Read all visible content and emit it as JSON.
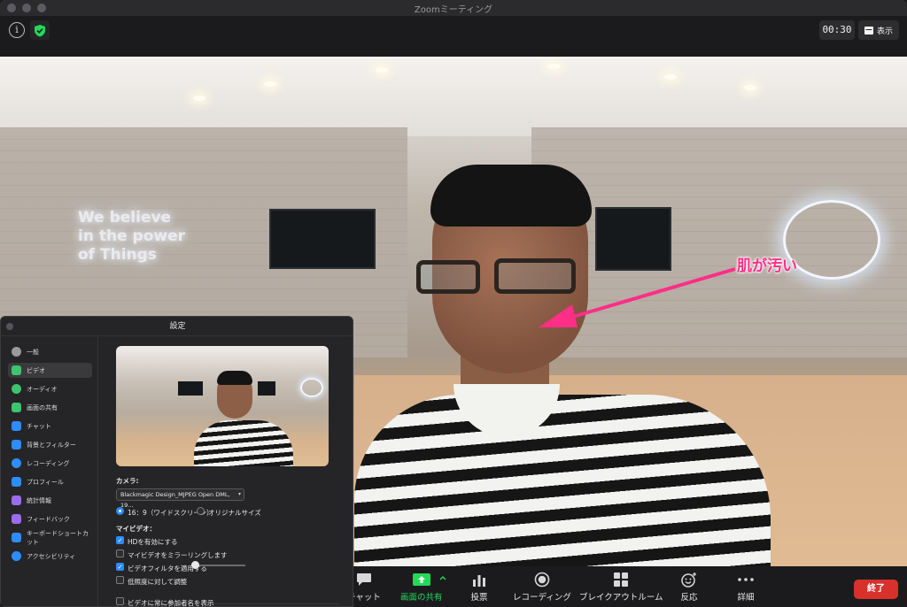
{
  "window": {
    "title": "Zoomミーティング"
  },
  "topbar": {
    "timer": "00:30",
    "view_label": "表示"
  },
  "annotation": {
    "text": "肌が汚い",
    "color": "#ff2e86"
  },
  "neon_sign": {
    "lines": [
      "We believe",
      "in the power",
      "of Things"
    ]
  },
  "toolbar": {
    "items": [
      {
        "label": "チャット",
        "icon": "chat-icon"
      },
      {
        "label": "画面の共有",
        "icon": "share-screen-icon"
      },
      {
        "label": "投票",
        "icon": "poll-icon"
      },
      {
        "label": "レコーディング",
        "icon": "record-icon"
      },
      {
        "label": "ブレイクアウトルーム",
        "icon": "breakout-icon"
      },
      {
        "label": "反応",
        "icon": "reaction-icon"
      },
      {
        "label": "詳細",
        "icon": "more-icon"
      }
    ],
    "end_label": "終了",
    "share_color": "#23d959",
    "end_color": "#d8312c"
  },
  "settings": {
    "title": "設定",
    "sidebar": [
      {
        "label": "一般",
        "color": "#9a9a9e"
      },
      {
        "label": "ビデオ",
        "color": "#3cc46e"
      },
      {
        "label": "オーディオ",
        "color": "#3cc46e"
      },
      {
        "label": "画面の共有",
        "color": "#3cc46e"
      },
      {
        "label": "チャット",
        "color": "#2d8cff"
      },
      {
        "label": "背景とフィルター",
        "color": "#2d8cff"
      },
      {
        "label": "レコーディング",
        "color": "#2d8cff"
      },
      {
        "label": "プロフィール",
        "color": "#2d8cff"
      },
      {
        "label": "統計情報",
        "color": "#9b6cf0"
      },
      {
        "label": "フィードバック",
        "color": "#9b6cf0"
      },
      {
        "label": "キーボードショートカット",
        "color": "#2d8cff"
      },
      {
        "label": "アクセシビリティ",
        "color": "#2d8cff"
      }
    ],
    "active_index": 1,
    "camera_label": "カメラ:",
    "camera_value": "Blackmagic Design_MJPEG Open DML, 19...",
    "ratio_169": "16：9（ワイドスクリーン）",
    "ratio_original": "オリジナルサイズ",
    "my_video_label": "マイビデオ：",
    "options": [
      {
        "label": "HDを有効にする",
        "checked": true
      },
      {
        "label": "マイビデオをミラーリングします",
        "checked": false
      },
      {
        "label": "ビデオフィルタを適用する",
        "checked": true
      },
      {
        "label": "低照度に対して調整",
        "checked": false
      }
    ],
    "bottom_option": {
      "label": "ビデオに常に参加者名を表示",
      "checked": false
    }
  }
}
